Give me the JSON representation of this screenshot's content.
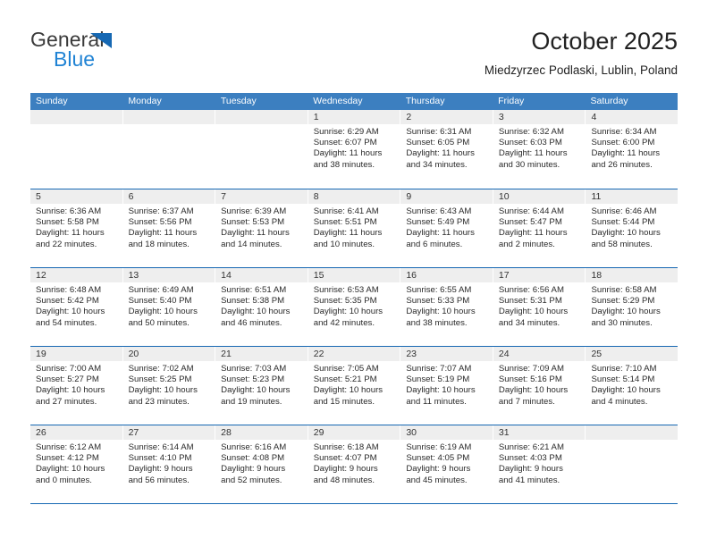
{
  "brand": {
    "name_top": "General",
    "name_bottom": "Blue",
    "triangle_icon": "triangle-icon",
    "color_dark": "#3a3a3a",
    "color_blue": "#2083d4"
  },
  "header": {
    "title": "October 2025",
    "subtitle": "Miedzyrzec Podlaski, Lublin, Poland"
  },
  "theme": {
    "header_row_bg": "#3c7fc0",
    "row_divider": "#1668b3",
    "day_head_bg": "#eeeeee",
    "text": "#2a2a2a"
  },
  "weekdays": [
    "Sunday",
    "Monday",
    "Tuesday",
    "Wednesday",
    "Thursday",
    "Friday",
    "Saturday"
  ],
  "weeks": [
    [
      {
        "day": "",
        "lines": []
      },
      {
        "day": "",
        "lines": []
      },
      {
        "day": "",
        "lines": []
      },
      {
        "day": "1",
        "lines": [
          "Sunrise: 6:29 AM",
          "Sunset: 6:07 PM",
          "Daylight: 11 hours",
          "and 38 minutes."
        ]
      },
      {
        "day": "2",
        "lines": [
          "Sunrise: 6:31 AM",
          "Sunset: 6:05 PM",
          "Daylight: 11 hours",
          "and 34 minutes."
        ]
      },
      {
        "day": "3",
        "lines": [
          "Sunrise: 6:32 AM",
          "Sunset: 6:03 PM",
          "Daylight: 11 hours",
          "and 30 minutes."
        ]
      },
      {
        "day": "4",
        "lines": [
          "Sunrise: 6:34 AM",
          "Sunset: 6:00 PM",
          "Daylight: 11 hours",
          "and 26 minutes."
        ]
      }
    ],
    [
      {
        "day": "5",
        "lines": [
          "Sunrise: 6:36 AM",
          "Sunset: 5:58 PM",
          "Daylight: 11 hours",
          "and 22 minutes."
        ]
      },
      {
        "day": "6",
        "lines": [
          "Sunrise: 6:37 AM",
          "Sunset: 5:56 PM",
          "Daylight: 11 hours",
          "and 18 minutes."
        ]
      },
      {
        "day": "7",
        "lines": [
          "Sunrise: 6:39 AM",
          "Sunset: 5:53 PM",
          "Daylight: 11 hours",
          "and 14 minutes."
        ]
      },
      {
        "day": "8",
        "lines": [
          "Sunrise: 6:41 AM",
          "Sunset: 5:51 PM",
          "Daylight: 11 hours",
          "and 10 minutes."
        ]
      },
      {
        "day": "9",
        "lines": [
          "Sunrise: 6:43 AM",
          "Sunset: 5:49 PM",
          "Daylight: 11 hours",
          "and 6 minutes."
        ]
      },
      {
        "day": "10",
        "lines": [
          "Sunrise: 6:44 AM",
          "Sunset: 5:47 PM",
          "Daylight: 11 hours",
          "and 2 minutes."
        ]
      },
      {
        "day": "11",
        "lines": [
          "Sunrise: 6:46 AM",
          "Sunset: 5:44 PM",
          "Daylight: 10 hours",
          "and 58 minutes."
        ]
      }
    ],
    [
      {
        "day": "12",
        "lines": [
          "Sunrise: 6:48 AM",
          "Sunset: 5:42 PM",
          "Daylight: 10 hours",
          "and 54 minutes."
        ]
      },
      {
        "day": "13",
        "lines": [
          "Sunrise: 6:49 AM",
          "Sunset: 5:40 PM",
          "Daylight: 10 hours",
          "and 50 minutes."
        ]
      },
      {
        "day": "14",
        "lines": [
          "Sunrise: 6:51 AM",
          "Sunset: 5:38 PM",
          "Daylight: 10 hours",
          "and 46 minutes."
        ]
      },
      {
        "day": "15",
        "lines": [
          "Sunrise: 6:53 AM",
          "Sunset: 5:35 PM",
          "Daylight: 10 hours",
          "and 42 minutes."
        ]
      },
      {
        "day": "16",
        "lines": [
          "Sunrise: 6:55 AM",
          "Sunset: 5:33 PM",
          "Daylight: 10 hours",
          "and 38 minutes."
        ]
      },
      {
        "day": "17",
        "lines": [
          "Sunrise: 6:56 AM",
          "Sunset: 5:31 PM",
          "Daylight: 10 hours",
          "and 34 minutes."
        ]
      },
      {
        "day": "18",
        "lines": [
          "Sunrise: 6:58 AM",
          "Sunset: 5:29 PM",
          "Daylight: 10 hours",
          "and 30 minutes."
        ]
      }
    ],
    [
      {
        "day": "19",
        "lines": [
          "Sunrise: 7:00 AM",
          "Sunset: 5:27 PM",
          "Daylight: 10 hours",
          "and 27 minutes."
        ]
      },
      {
        "day": "20",
        "lines": [
          "Sunrise: 7:02 AM",
          "Sunset: 5:25 PM",
          "Daylight: 10 hours",
          "and 23 minutes."
        ]
      },
      {
        "day": "21",
        "lines": [
          "Sunrise: 7:03 AM",
          "Sunset: 5:23 PM",
          "Daylight: 10 hours",
          "and 19 minutes."
        ]
      },
      {
        "day": "22",
        "lines": [
          "Sunrise: 7:05 AM",
          "Sunset: 5:21 PM",
          "Daylight: 10 hours",
          "and 15 minutes."
        ]
      },
      {
        "day": "23",
        "lines": [
          "Sunrise: 7:07 AM",
          "Sunset: 5:19 PM",
          "Daylight: 10 hours",
          "and 11 minutes."
        ]
      },
      {
        "day": "24",
        "lines": [
          "Sunrise: 7:09 AM",
          "Sunset: 5:16 PM",
          "Daylight: 10 hours",
          "and 7 minutes."
        ]
      },
      {
        "day": "25",
        "lines": [
          "Sunrise: 7:10 AM",
          "Sunset: 5:14 PM",
          "Daylight: 10 hours",
          "and 4 minutes."
        ]
      }
    ],
    [
      {
        "day": "26",
        "lines": [
          "Sunrise: 6:12 AM",
          "Sunset: 4:12 PM",
          "Daylight: 10 hours",
          "and 0 minutes."
        ]
      },
      {
        "day": "27",
        "lines": [
          "Sunrise: 6:14 AM",
          "Sunset: 4:10 PM",
          "Daylight: 9 hours",
          "and 56 minutes."
        ]
      },
      {
        "day": "28",
        "lines": [
          "Sunrise: 6:16 AM",
          "Sunset: 4:08 PM",
          "Daylight: 9 hours",
          "and 52 minutes."
        ]
      },
      {
        "day": "29",
        "lines": [
          "Sunrise: 6:18 AM",
          "Sunset: 4:07 PM",
          "Daylight: 9 hours",
          "and 48 minutes."
        ]
      },
      {
        "day": "30",
        "lines": [
          "Sunrise: 6:19 AM",
          "Sunset: 4:05 PM",
          "Daylight: 9 hours",
          "and 45 minutes."
        ]
      },
      {
        "day": "31",
        "lines": [
          "Sunrise: 6:21 AM",
          "Sunset: 4:03 PM",
          "Daylight: 9 hours",
          "and 41 minutes."
        ]
      },
      {
        "day": "",
        "lines": []
      }
    ]
  ]
}
